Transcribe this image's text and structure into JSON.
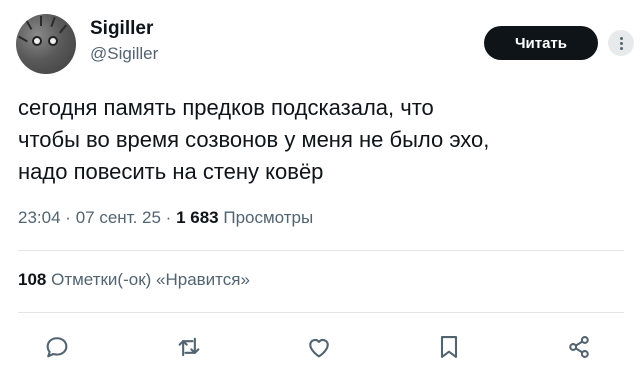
{
  "author": {
    "display_name": "Sigiller",
    "handle": "@Sigiller"
  },
  "follow_button": {
    "label": "Читать"
  },
  "tweet": {
    "lines": [
      "сегодня память предков подсказала, что",
      "чтобы во время созвонов у меня не было эхо,",
      "надо повесить на стену ковёр"
    ]
  },
  "meta": {
    "time": "23:04",
    "sep": "·",
    "date": "07 сент. 25",
    "views_count": "1 683",
    "views_label": "Просмотры"
  },
  "likes": {
    "count": "108",
    "label": "Отметки(-ок) «Нравится»"
  },
  "actions": {
    "icons": [
      "reply-icon",
      "retweet-icon",
      "like-icon",
      "bookmark-icon",
      "share-icon"
    ]
  },
  "colors": {
    "text": "#0f1419",
    "secondary": "#536471",
    "button_bg": "#0f1419",
    "divider": "#e3e6e8"
  }
}
